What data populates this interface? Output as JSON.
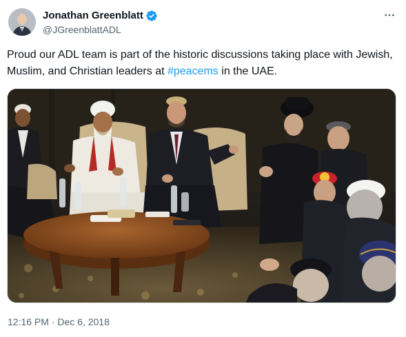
{
  "author": {
    "display_name": "Jonathan Greenblatt",
    "handle": "@JGreenblattADL",
    "verified": true
  },
  "tweet": {
    "text_before": "Proud our ADL team is part of the historic discussions taking place with Jewish, Muslim, and Christian leaders at ",
    "hashtag": "#peacems",
    "text_after": " in the UAE.",
    "timestamp": "12:16 PM · Dec 6, 2018"
  },
  "colors": {
    "accent": "#1d9bf0",
    "secondary_text": "#536471",
    "primary_text": "#0f1419"
  },
  "icons": {
    "verified": "verified-badge-icon",
    "more": "more-options-icon"
  }
}
